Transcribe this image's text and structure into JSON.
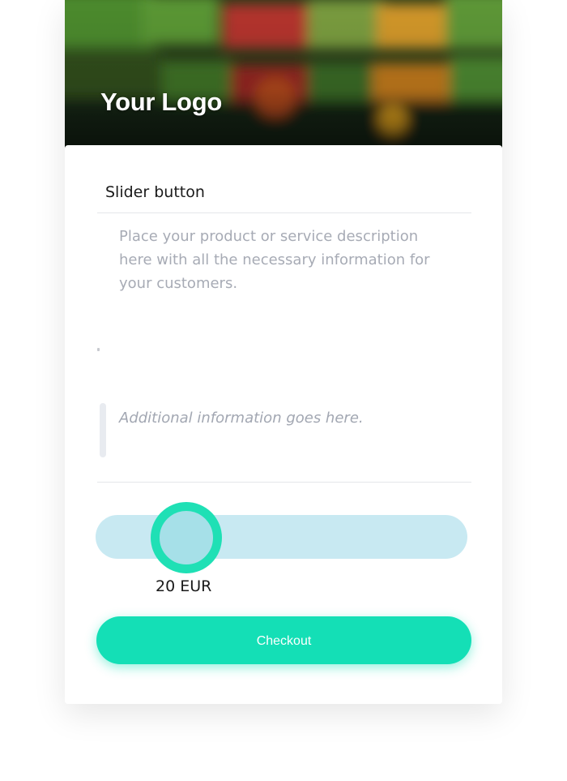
{
  "header": {
    "logo_text": "Your Logo",
    "background_image": "blurred-vegetable-market"
  },
  "product": {
    "title": "Slider button",
    "description": "Place your product or service description here with all the necessary information for your customers.",
    "additional_info": "Additional information goes here."
  },
  "slider": {
    "value_label": "20 EUR",
    "value": 20,
    "currency": "EUR"
  },
  "checkout": {
    "label": "Checkout"
  },
  "colors": {
    "accent": "#14DFB6",
    "slider_track": "#C8E9F2",
    "slider_thumb_fill": "#A6E0E8",
    "slider_thumb_ring": "#1FE0B5",
    "muted_text": "#A7ABB5",
    "title_text": "#1A1A1A"
  }
}
